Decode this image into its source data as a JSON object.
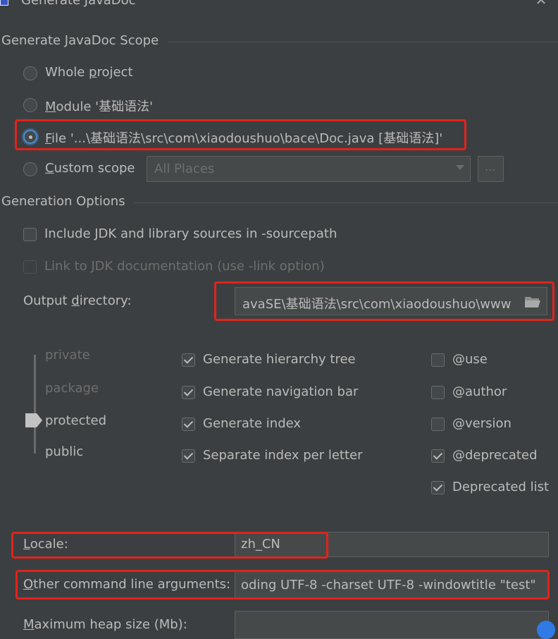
{
  "window": {
    "title": "Generate JavaDoc",
    "app_icon": "javadoc-app-icon",
    "close_icon": "close-icon"
  },
  "scope": {
    "title": "Generate JavaDoc Scope",
    "options": [
      {
        "label": "Whole project",
        "underline_char": "p",
        "checked": false
      },
      {
        "label": "Module '基础语法'",
        "checked": false
      },
      {
        "label": "File '...\\基础语法\\src\\com\\xiaodoushuo\\bace\\Doc.java [基础语法]'",
        "checked": true
      },
      {
        "label": "Custom scope",
        "checked": false
      }
    ],
    "custom_scope_value": "All Places",
    "browse_label": "..."
  },
  "options": {
    "title": "Generation Options",
    "include_jdk": {
      "label": "Include JDK and library sources in -sourcepath",
      "checked": false
    },
    "link_jdk": {
      "label": "Link to JDK documentation (use -link option)",
      "checked": false,
      "disabled": true
    },
    "output_dir": {
      "label": "Output directory:",
      "value": "avaSE\\基础语法\\src\\com\\xiaodoushuo\\www"
    }
  },
  "visibility": {
    "levels": [
      "private",
      "package",
      "protected",
      "public"
    ],
    "selected": "protected"
  },
  "generate": [
    {
      "label": "Generate hierarchy tree",
      "checked": true
    },
    {
      "label": "Generate navigation bar",
      "checked": true
    },
    {
      "label": "Generate index",
      "checked": true
    },
    {
      "label": "Separate index per letter",
      "checked": true
    }
  ],
  "tags": [
    {
      "label": "@use",
      "checked": false
    },
    {
      "label": "@author",
      "checked": false
    },
    {
      "label": "@version",
      "checked": false
    },
    {
      "label": "@deprecated",
      "checked": true
    },
    {
      "label": "Deprecated list",
      "checked": true
    }
  ],
  "locale": {
    "label": "Locale:",
    "value": "zh_CN"
  },
  "other_args": {
    "label": "Other command line arguments:",
    "value": "oding UTF-8 -charset UTF-8 -windowtitle \"test\""
  },
  "max_heap": {
    "label": "Maximum heap size (Mb):",
    "value": ""
  },
  "colors": {
    "background": "#3c3f41",
    "text": "#bbbbbb",
    "highlight": "#e2231a",
    "accent": "#4a88c7"
  }
}
